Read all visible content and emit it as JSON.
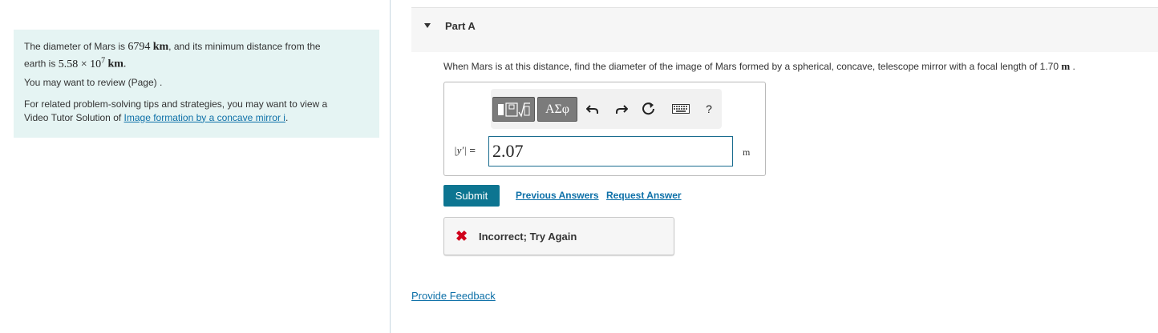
{
  "intro": {
    "sentence1_prefix": "The diameter of Mars is ",
    "mars_diameter": "6794",
    "unit_km": "km",
    "sentence1_mid": ", and its minimum distance from the",
    "sentence1_line2_prefix": "earth is ",
    "distance_mantissa": "5.58",
    "times": "×",
    "distance_base": "10",
    "distance_exponent": "7",
    "review_text": "You may want to review (Page) .",
    "tips_line1": "For related problem-solving tips and strategies, you may want to view a",
    "tips_line2_prefix": "Video Tutor Solution of ",
    "tips_link": "Image formation by a concave mirror i",
    "tips_suffix": "."
  },
  "part": {
    "title": "Part A"
  },
  "question": {
    "text": "When Mars is at this distance, find the diameter of the image of Mars formed by a spherical, concave, telescope mirror with a focal length of 1.70 ",
    "unit": "m",
    "suffix": " ."
  },
  "toolbar": {
    "greek_label": "ΑΣφ",
    "help_label": "?",
    "icons": [
      "templates-icon",
      "greek-letters-icon",
      "undo-icon",
      "redo-icon",
      "reset-icon",
      "keyboard-icon",
      "help-icon"
    ]
  },
  "answer": {
    "label_var": "|y′|",
    "label_eq": " =",
    "value": "2.07",
    "unit": "m"
  },
  "actions": {
    "submit": "Submit",
    "previous_answers": "Previous Answers",
    "request_answer": "Request Answer"
  },
  "feedback": {
    "status_text": "Incorrect; Try Again"
  },
  "footer": {
    "provide_feedback": "Provide Feedback"
  },
  "colors": {
    "info_bg": "#e5f4f3",
    "link": "#0d70a8",
    "submit_bg": "#0d7591",
    "error": "#d0021b"
  }
}
